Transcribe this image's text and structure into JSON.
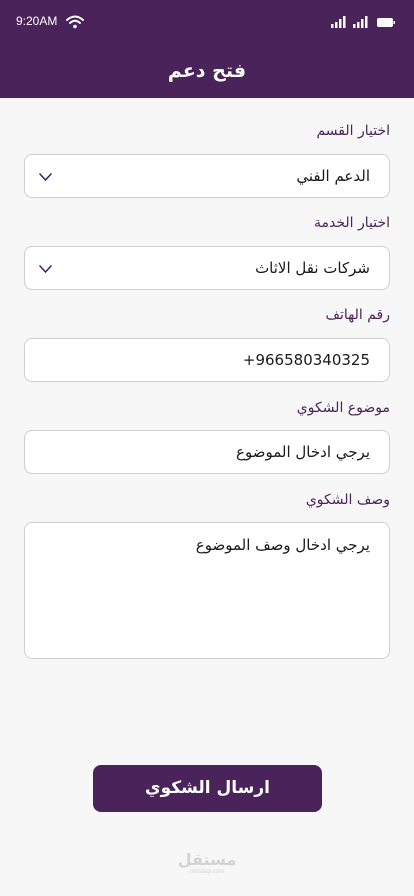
{
  "status_bar": {
    "time": "9:20AM"
  },
  "header": {
    "title": "فتح دعم"
  },
  "form": {
    "department": {
      "label": "اختيار القسم",
      "value": "الدعم الفني"
    },
    "service": {
      "label": "اختيار الخدمة",
      "value": "شركات نقل الاثاث"
    },
    "phone": {
      "label": "رقم الهاتف",
      "value": "+966580340325"
    },
    "subject": {
      "label": "موضوع الشكوي",
      "placeholder": "يرجي ادخال الموضوع"
    },
    "description": {
      "label": "وصف الشكوي",
      "placeholder": "يرجي ادخال وصف الموضوع"
    }
  },
  "submit": {
    "label": "ارسال الشكوي"
  },
  "watermark": {
    "text": "مستقل",
    "sub": "mostaql.com"
  },
  "colors": {
    "brand": "#4a235a",
    "background": "#f8f7f8",
    "border": "#cfcfcf"
  },
  "icons": [
    "wifi-icon",
    "signal-icon",
    "battery-icon",
    "chevron-down-icon"
  ]
}
